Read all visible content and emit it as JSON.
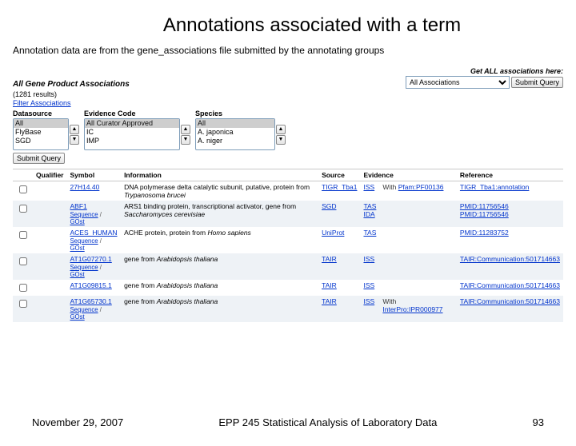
{
  "slide": {
    "title": "Annotations associated with a term",
    "subtitle": "Annotation data are from the gene_associations file submitted by the annotating groups"
  },
  "section": {
    "heading": "All Gene Product Associations",
    "results": "(1281 results)",
    "filter_link": "Filter Associations",
    "get_all_label": "Get ALL associations here:",
    "assoc_selected": "All Associations",
    "submit_query": "Submit Query"
  },
  "filters": {
    "datasource": {
      "label": "Datasource",
      "options": [
        "All",
        "FlyBase",
        "SGD"
      ]
    },
    "evidence": {
      "label": "Evidence Code",
      "options": [
        "All Curator Approved",
        "IC",
        "IMP"
      ]
    },
    "species": {
      "label": "Species",
      "options": [
        "All",
        "A. japonica",
        "A. niger"
      ]
    },
    "submit": "Submit Query"
  },
  "table": {
    "headers": {
      "qualifier": "Qualifier",
      "symbol": "Symbol",
      "information": "Information",
      "source": "Source",
      "evidence": "Evidence",
      "reference": "Reference"
    },
    "rows": [
      {
        "bg": "rowA",
        "symbol": "27H14.40",
        "sub": "",
        "info_plain": "DNA polymerase delta catalytic subunit, putative, protein from ",
        "info_italic": "Trypanosoma brucei",
        "source": "TIGR_Tba1",
        "evidence": "ISS",
        "ev_with": "With Pfam:PF00136",
        "reference": "TIGR_Tba1:annotation"
      },
      {
        "bg": "rowB",
        "symbol": "ABF1",
        "sub": "Sequence / GOst",
        "info_plain": "ARS1 binding protein, transcriptional activator, gene from ",
        "info_italic": "Saccharomyces cerevisiae",
        "source": "SGD",
        "evidence": "TAS\nIDA",
        "ev_with": "",
        "reference": "PMID:11756546\nPMID:11756546"
      },
      {
        "bg": "rowA",
        "symbol": "ACES_HUMAN",
        "sub": "Sequence / GOst",
        "info_plain": "ACHE protein, protein from ",
        "info_italic": "Homo sapiens",
        "source": "UniProt",
        "evidence": "TAS",
        "ev_with": "",
        "reference": "PMID:11283752"
      },
      {
        "bg": "rowB",
        "symbol": "AT1G07270.1",
        "sub": "Sequence / GOst",
        "info_plain": "gene from ",
        "info_italic": "Arabidopsis thaliana",
        "source": "TAIR",
        "evidence": "ISS",
        "ev_with": "",
        "reference": "TAIR:Communication:501714663"
      },
      {
        "bg": "rowA",
        "symbol": "AT1G09815.1",
        "sub": "",
        "info_plain": "gene from ",
        "info_italic": "Arabidopsis thaliana",
        "source": "TAIR",
        "evidence": "ISS",
        "ev_with": "",
        "reference": "TAIR:Communication:501714663"
      },
      {
        "bg": "rowB",
        "symbol": "AT1G65730.1",
        "sub": "Sequence / GOst",
        "info_plain": "gene from ",
        "info_italic": "Arabidopsis thaliana",
        "source": "TAIR",
        "evidence": "ISS",
        "ev_with": "With InterPro:IPR000977",
        "reference": "TAIR:Communication:501714663"
      }
    ]
  },
  "footer": {
    "date": "November 29, 2007",
    "course": "EPP 245 Statistical Analysis of Laboratory Data",
    "page": "93"
  },
  "glyph": {
    "up": "▲",
    "down": "▼"
  }
}
